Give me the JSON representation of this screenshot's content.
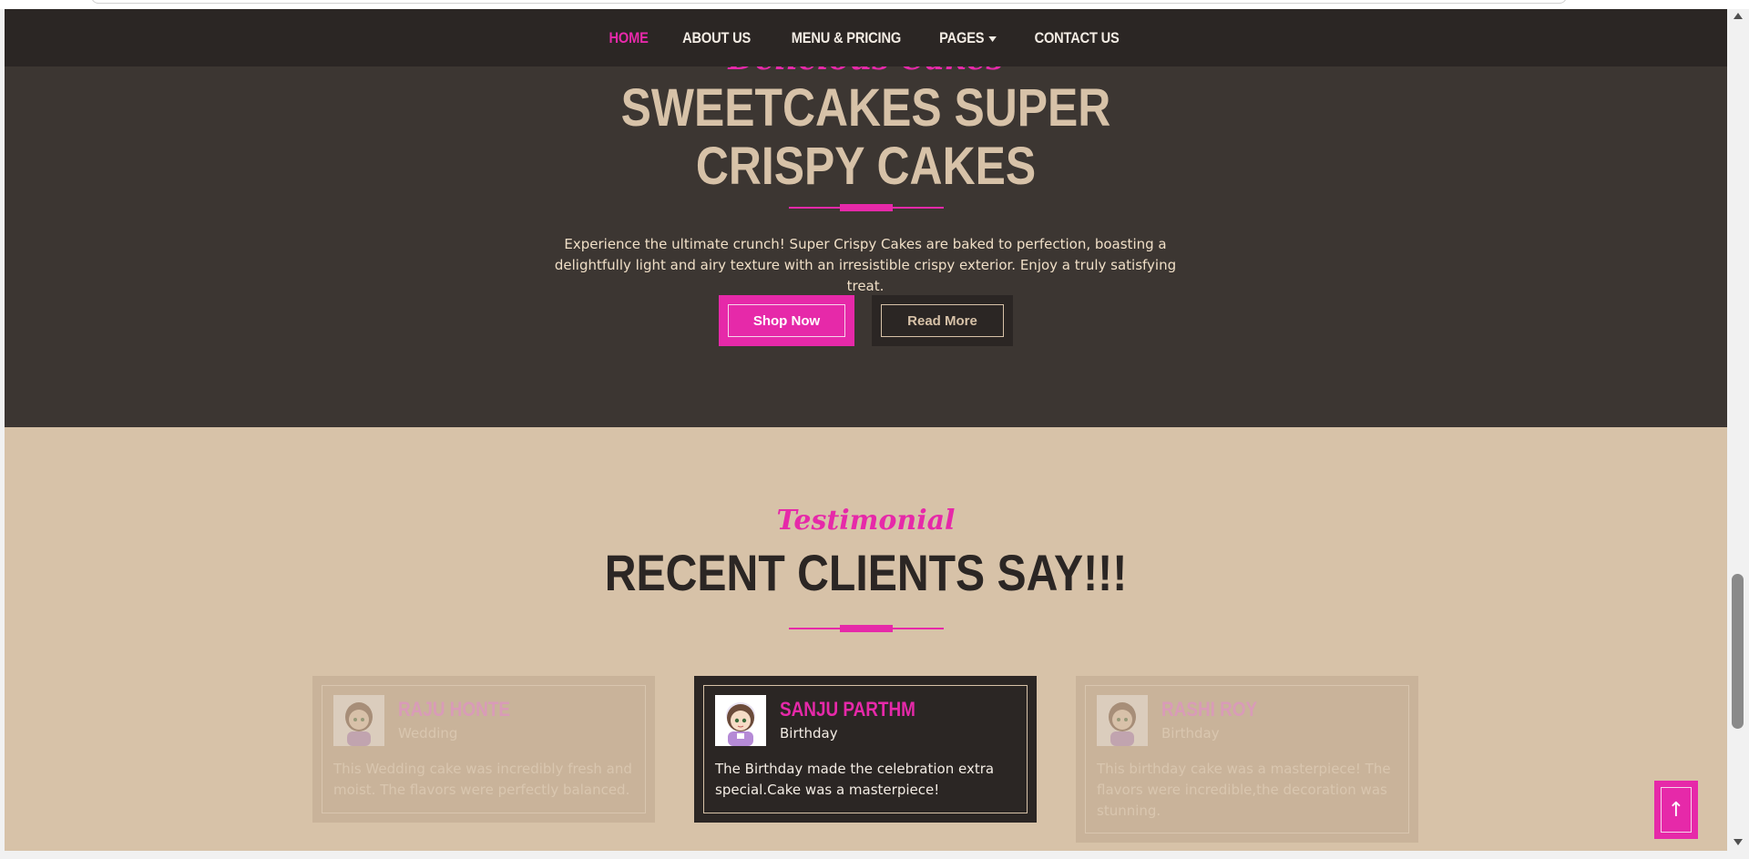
{
  "nav": {
    "items": [
      {
        "label": "HOME",
        "active": true
      },
      {
        "label": "ABOUT US"
      },
      {
        "label": "MENU & PRICING"
      },
      {
        "label": "PAGES",
        "dropdown": true
      },
      {
        "label": "CONTACT US"
      }
    ]
  },
  "hero": {
    "script_text": "Delicious Cakes",
    "title_line1": "SWEETCAKES SUPER",
    "title_line2": "CRISPY CAKES",
    "description": "Experience the ultimate crunch! Super Crispy Cakes are baked to perfection, boasting a delightfully light and airy texture with an irresistible crispy exterior. Enjoy a truly satisfying treat.",
    "shop_button": "Shop Now",
    "read_button": "Read More"
  },
  "testimonial": {
    "script_text": "Testimonial",
    "title": "RECENT CLIENTS SAY!!!",
    "cards": [
      {
        "name": "RAJU HONTE",
        "category": "Wedding",
        "text": "This Wedding cake was incredibly fresh and moist. The flavors were perfectly balanced."
      },
      {
        "name": "SANJU PARTHM",
        "category": "Birthday",
        "text": "The Birthday made the celebration extra special.Cake was a masterpiece!"
      },
      {
        "name": "RASHI ROY",
        "category": "Birthday",
        "text": "This birthday cake was a masterpiece! The flavors were incredible,the decoration was stunning."
      }
    ]
  },
  "back_to_top": "↑",
  "colors": {
    "accent": "#e629a9",
    "dark": "#2b2624",
    "hero_bg": "#3c3632",
    "beige": "#d7c2a8"
  }
}
